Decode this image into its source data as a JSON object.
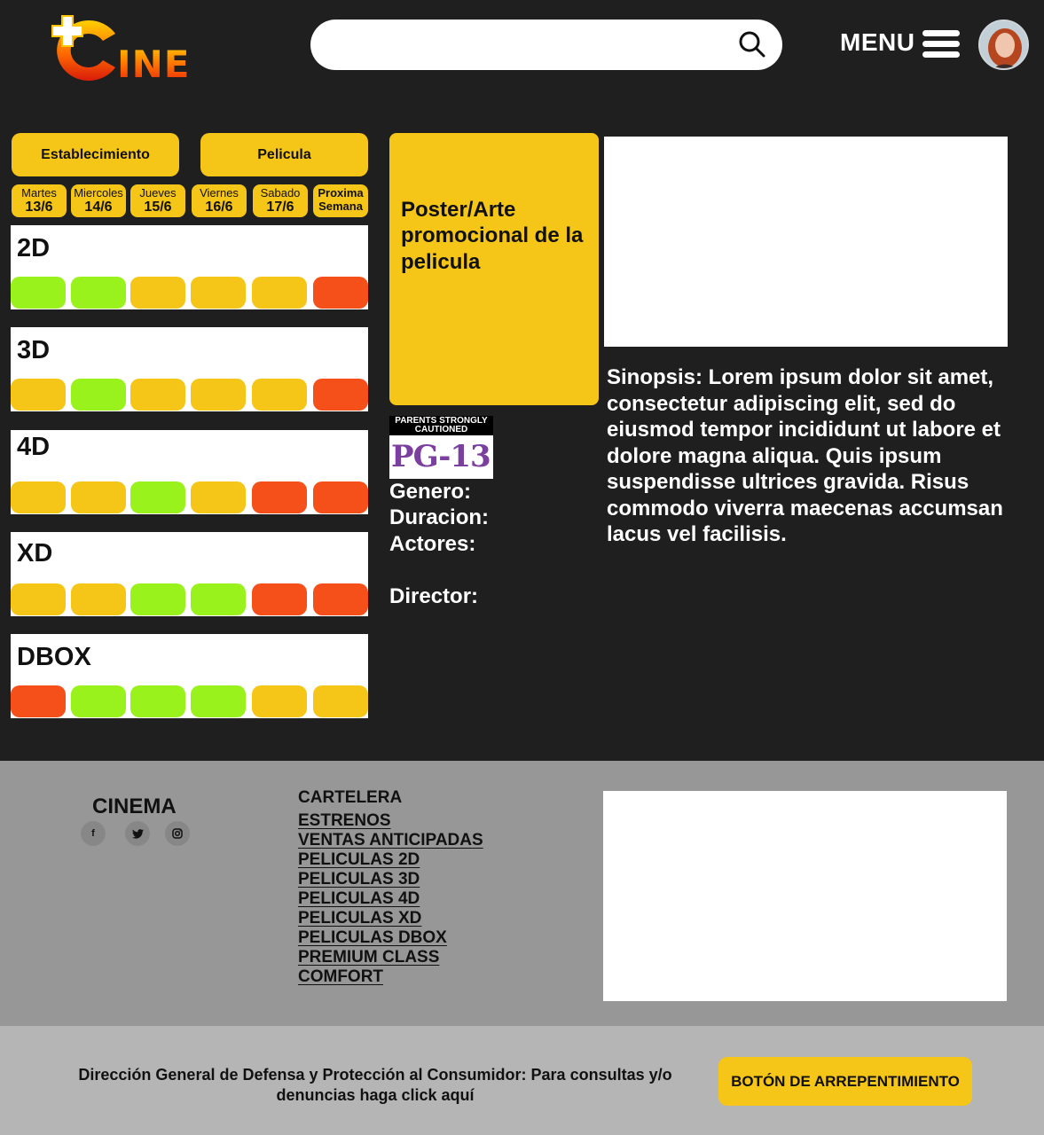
{
  "brand": {
    "logo_text": "INE"
  },
  "header": {
    "search": {
      "placeholder": "",
      "value": ""
    },
    "menu_label": "MENU"
  },
  "filters": {
    "establishment_label": "Establecimiento",
    "movie_label": "Pelicula"
  },
  "days": [
    {
      "name": "Martes",
      "date": "13/6"
    },
    {
      "name": "Miercoles",
      "date": "14/6"
    },
    {
      "name": "Jueves",
      "date": "15/6"
    },
    {
      "name": "Viernes",
      "date": "16/6"
    },
    {
      "name": "Sabado",
      "date": "17/6"
    },
    {
      "name": "Proxima",
      "date": "Semana"
    }
  ],
  "availability_colors": {
    "available": "#99f21c",
    "limited": "#f5c518",
    "sold_out": "#f5501a"
  },
  "formats": [
    {
      "name": "2D",
      "slots": [
        "available",
        "available",
        "limited",
        "limited",
        "limited",
        "sold_out"
      ]
    },
    {
      "name": "3D",
      "slots": [
        "limited",
        "available",
        "limited",
        "limited",
        "limited",
        "sold_out"
      ]
    },
    {
      "name": "4D",
      "slots": [
        "limited",
        "limited",
        "available",
        "limited",
        "sold_out",
        "sold_out"
      ]
    },
    {
      "name": "XD",
      "slots": [
        "limited",
        "limited",
        "available",
        "available",
        "sold_out",
        "sold_out"
      ]
    },
    {
      "name": "DBOX",
      "slots": [
        "sold_out",
        "available",
        "available",
        "available",
        "limited",
        "limited"
      ]
    }
  ],
  "movie": {
    "poster_text": "Poster/Arte promocional de la pelicula",
    "rating_top": "PARENTS STRONGLY CAUTIONED",
    "rating_code": "PG-13",
    "genre_label": "Genero:",
    "duration_label": "Duracion:",
    "actors_label": "Actores:",
    "director_label": "Director:",
    "synopsis": "Sinopsis:  Lorem ipsum dolor sit amet, consectetur adipiscing elit, sed do eiusmod tempor incididunt ut labore et dolore magna aliqua. Quis ipsum suspendisse ultrices gravida. Risus commodo viverra maecenas accumsan lacus vel facilisis."
  },
  "footer": {
    "brand": "CINEMA",
    "social": [
      "facebook-icon",
      "twitter-icon",
      "instagram-icon"
    ],
    "links_heading": "CARTELERA",
    "links": [
      "ESTRENOS",
      "VENTAS ANTICIPADAS",
      "PELICULAS 2D",
      "PELICULAS 3D",
      "PELICULAS 4D",
      "PELICULAS XD",
      "PELICULAS DBOX",
      "PREMIUM CLASS",
      "COMFORT"
    ],
    "legal_text": "Dirección General de Defensa y Protección al Consumidor: Para consultas y/o denuncias haga click aquí",
    "regret_button": "BOTÓN DE ARREPENTIMIENTO"
  }
}
